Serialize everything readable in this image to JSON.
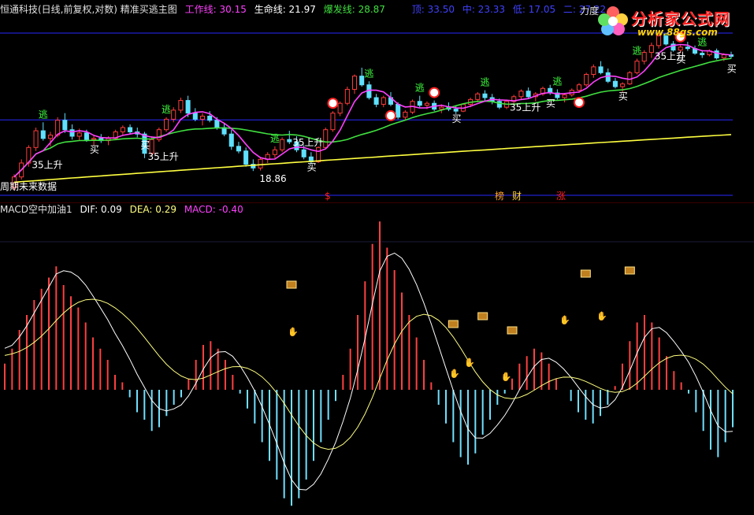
{
  "header_main": {
    "title": "恒通科技(日线,前复权,对数) 精准买逃主图",
    "work_label": "工作线: 30.15",
    "life_label": "生命线: 21.97",
    "burst_label": "爆发线: 28.87",
    "top_label": "顶: 33.50",
    "mid_label": "中: 23.33",
    "bottom_label": "低: 17.05",
    "two_label": "二: 27.22",
    "right_cut": "力度"
  },
  "header_macd": {
    "title": "MACD空中加油1",
    "dif_label": "DIF: 0.09",
    "dea_label": "DEA: 0.29",
    "macd_label": "MACD: -0.40"
  },
  "watermark": {
    "line1": "分析家公式网",
    "line2": "www.88gs.com"
  },
  "colors": {
    "bg": "#000000",
    "up": "#ff3c3c",
    "down": "#5fe0ff",
    "work": "#ff40ff",
    "life": "#40e040",
    "burst": "#ffff40",
    "hline": "#3030ff",
    "macd_pos": "#ff4040",
    "macd_neg": "#70e0ff",
    "dif": "#ffffff",
    "dea": "#ffff80",
    "signal_text": "#ffffff"
  },
  "annotations": {
    "low_price": "18.86",
    "left_text": "35上升",
    "unfinished": "周期未来数据",
    "escape": "逃",
    "buy": "买",
    "rise35": "35上升",
    "bottom_marks": [
      "$",
      "榜",
      "财",
      "涨"
    ]
  },
  "chart_data": {
    "type": "candlestick",
    "price_axis": "log",
    "levels": {
      "top": 33.5,
      "mid": 23.33,
      "low": 17.05,
      "two": 27.22
    },
    "lines": {
      "work": 30.15,
      "life": 21.97,
      "burst": 28.87
    },
    "low_marker": 18.86,
    "candles": [
      [
        17.6,
        18.6,
        17.4,
        18.4
      ],
      [
        18.4,
        19.8,
        18.2,
        19.5
      ],
      [
        19.5,
        21.0,
        19.2,
        20.8
      ],
      [
        20.8,
        22.6,
        20.5,
        22.3
      ],
      [
        22.3,
        23.1,
        21.4,
        21.6
      ],
      [
        21.6,
        22.2,
        20.9,
        21.9
      ],
      [
        21.9,
        23.6,
        21.7,
        23.3
      ],
      [
        23.3,
        24.0,
        22.1,
        22.4
      ],
      [
        22.4,
        22.9,
        21.5,
        21.8
      ],
      [
        21.8,
        22.5,
        21.4,
        22.1
      ],
      [
        22.1,
        22.4,
        21.3,
        21.5
      ],
      [
        21.5,
        21.9,
        21.0,
        21.6
      ],
      [
        21.6,
        22.0,
        21.2,
        21.4
      ],
      [
        21.4,
        21.8,
        21.0,
        21.6
      ],
      [
        21.6,
        22.4,
        21.5,
        22.2
      ],
      [
        22.2,
        22.8,
        21.9,
        22.6
      ],
      [
        22.6,
        22.9,
        22.0,
        22.2
      ],
      [
        22.2,
        22.6,
        21.7,
        22.0
      ],
      [
        22.0,
        22.2,
        19.9,
        20.3
      ],
      [
        20.3,
        21.8,
        20.1,
        21.5
      ],
      [
        21.5,
        22.6,
        21.3,
        22.4
      ],
      [
        22.4,
        23.6,
        22.2,
        23.4
      ],
      [
        23.4,
        24.6,
        23.1,
        24.3
      ],
      [
        24.3,
        25.6,
        24.0,
        25.3
      ],
      [
        25.3,
        25.8,
        23.6,
        24.0
      ],
      [
        24.0,
        24.5,
        23.2,
        23.4
      ],
      [
        23.4,
        24.0,
        22.8,
        23.7
      ],
      [
        23.7,
        24.2,
        23.1,
        23.3
      ],
      [
        23.3,
        23.6,
        22.4,
        22.6
      ],
      [
        22.6,
        23.0,
        21.8,
        22.0
      ],
      [
        22.0,
        22.4,
        20.6,
        20.9
      ],
      [
        20.9,
        21.3,
        20.3,
        20.5
      ],
      [
        20.5,
        20.8,
        19.2,
        19.4
      ],
      [
        19.4,
        19.8,
        18.86,
        19.1
      ],
      [
        19.1,
        20.0,
        18.9,
        19.8
      ],
      [
        19.8,
        20.4,
        19.5,
        20.2
      ],
      [
        20.2,
        20.9,
        19.9,
        20.6
      ],
      [
        20.6,
        21.7,
        20.4,
        21.5
      ],
      [
        21.5,
        22.3,
        21.1,
        21.3
      ],
      [
        21.3,
        21.8,
        20.4,
        20.6
      ],
      [
        20.6,
        21.0,
        19.8,
        20.0
      ],
      [
        20.0,
        20.4,
        19.4,
        19.6
      ],
      [
        19.6,
        20.9,
        19.5,
        20.8
      ],
      [
        20.8,
        22.6,
        20.7,
        22.4
      ],
      [
        22.4,
        24.2,
        22.2,
        24.0
      ],
      [
        24.0,
        25.2,
        23.7,
        25.0
      ],
      [
        25.0,
        26.8,
        24.8,
        26.5
      ],
      [
        26.5,
        28.2,
        26.0,
        28.0
      ],
      [
        28.0,
        29.0,
        26.8,
        27.0
      ],
      [
        27.0,
        27.4,
        25.4,
        25.6
      ],
      [
        25.6,
        26.0,
        24.6,
        24.9
      ],
      [
        24.9,
        25.8,
        24.6,
        25.6
      ],
      [
        25.6,
        26.2,
        24.7,
        24.9
      ],
      [
        24.9,
        25.1,
        23.4,
        23.6
      ],
      [
        23.6,
        24.3,
        23.3,
        24.1
      ],
      [
        24.1,
        25.4,
        23.9,
        25.2
      ],
      [
        25.2,
        25.8,
        24.6,
        24.8
      ],
      [
        24.8,
        25.2,
        24.4,
        25.0
      ],
      [
        25.0,
        25.3,
        24.2,
        24.4
      ],
      [
        24.4,
        24.9,
        24.0,
        24.6
      ],
      [
        24.6,
        25.1,
        24.2,
        24.4
      ],
      [
        24.4,
        24.7,
        23.9,
        24.2
      ],
      [
        24.2,
        25.0,
        24.1,
        24.9
      ],
      [
        24.9,
        25.6,
        24.6,
        25.4
      ],
      [
        25.4,
        26.2,
        25.1,
        26.0
      ],
      [
        26.0,
        26.4,
        25.3,
        25.6
      ],
      [
        25.6,
        26.0,
        24.9,
        25.2
      ],
      [
        25.2,
        25.5,
        24.4,
        24.6
      ],
      [
        24.6,
        25.4,
        24.4,
        25.2
      ],
      [
        25.2,
        25.9,
        24.9,
        25.7
      ],
      [
        25.7,
        26.5,
        25.4,
        26.3
      ],
      [
        26.3,
        26.7,
        25.5,
        25.7
      ],
      [
        25.7,
        26.2,
        25.2,
        26.0
      ],
      [
        26.0,
        26.8,
        25.8,
        26.6
      ],
      [
        26.6,
        27.0,
        25.9,
        26.1
      ],
      [
        26.1,
        26.5,
        25.4,
        25.6
      ],
      [
        25.6,
        26.1,
        25.1,
        25.9
      ],
      [
        25.9,
        26.6,
        25.7,
        26.4
      ],
      [
        26.4,
        27.2,
        26.1,
        27.0
      ],
      [
        27.0,
        28.4,
        26.8,
        28.2
      ],
      [
        28.2,
        29.4,
        27.8,
        29.1
      ],
      [
        29.1,
        29.8,
        28.2,
        28.4
      ],
      [
        28.4,
        28.9,
        27.2,
        27.4
      ],
      [
        27.4,
        27.8,
        26.6,
        26.8
      ],
      [
        26.8,
        27.3,
        26.2,
        27.1
      ],
      [
        27.1,
        28.6,
        27.0,
        28.4
      ],
      [
        28.4,
        30.1,
        28.2,
        29.8
      ],
      [
        29.8,
        31.2,
        29.4,
        30.9
      ],
      [
        30.9,
        32.2,
        30.2,
        31.8
      ],
      [
        31.8,
        33.5,
        31.4,
        33.1
      ],
      [
        33.1,
        33.5,
        31.8,
        32.0
      ],
      [
        32.0,
        32.4,
        31.0,
        31.2
      ],
      [
        31.2,
        31.9,
        30.8,
        31.6
      ],
      [
        31.6,
        32.3,
        31.1,
        31.4
      ],
      [
        31.4,
        31.8,
        30.6,
        30.8
      ],
      [
        30.8,
        31.2,
        30.2,
        30.6
      ],
      [
        30.6,
        31.3,
        30.4,
        31.1
      ],
      [
        31.1,
        31.4,
        30.0,
        30.2
      ],
      [
        30.2,
        30.8,
        29.8,
        30.6
      ],
      [
        30.6,
        31.0,
        30.1,
        30.4
      ]
    ],
    "macd": {
      "hist": [
        0.35,
        0.55,
        0.8,
        1.0,
        1.2,
        1.35,
        1.5,
        1.65,
        1.4,
        1.25,
        1.1,
        0.9,
        0.7,
        0.55,
        0.4,
        0.2,
        0.1,
        -0.1,
        -0.3,
        -0.4,
        -0.55,
        -0.5,
        -0.35,
        -0.2,
        -0.1,
        0.15,
        0.4,
        0.6,
        0.65,
        0.55,
        0.4,
        0.2,
        -0.05,
        -0.25,
        -0.45,
        -0.7,
        -0.95,
        -1.2,
        -1.45,
        -1.55,
        -1.45,
        -1.2,
        -0.95,
        -0.7,
        -0.4,
        -0.15,
        0.2,
        0.55,
        1.0,
        1.45,
        1.95,
        2.25,
        1.9,
        1.6,
        1.3,
        1.0,
        0.7,
        0.4,
        0.1,
        -0.2,
        -0.45,
        -0.7,
        -0.9,
        -1.0,
        -0.85,
        -0.6,
        -0.4,
        -0.2,
        -0.05,
        0.15,
        0.35,
        0.45,
        0.55,
        0.5,
        0.35,
        0.15,
        0.0,
        -0.15,
        -0.3,
        -0.4,
        -0.45,
        -0.35,
        -0.2,
        0.05,
        0.35,
        0.65,
        0.9,
        1.0,
        0.9,
        0.7,
        0.45,
        0.25,
        0.1,
        -0.05,
        -0.3,
        -0.55,
        -0.8,
        -0.9,
        -0.7,
        -0.5
      ]
    }
  }
}
